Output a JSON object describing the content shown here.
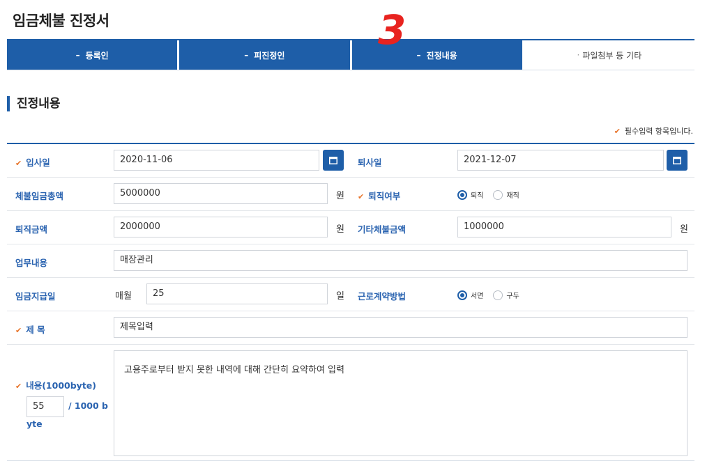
{
  "page": {
    "title": "임금체불 진정서",
    "step_mark": "3"
  },
  "tabs": [
    {
      "label": "등록인",
      "active": true
    },
    {
      "label": "피진정인",
      "active": true
    },
    {
      "label": "진정내용",
      "active": true
    },
    {
      "label": "파일첨부 등 기타",
      "active": false
    }
  ],
  "section": {
    "title": "진정내용",
    "required_note": "필수입력 항목입니다."
  },
  "form": {
    "hire_date": {
      "label": "입사일",
      "value": "2020-11-06"
    },
    "resign_date": {
      "label": "퇴사일",
      "value": "2021-12-07"
    },
    "unpaid_total": {
      "label": "체불임금총액",
      "value": "5000000",
      "unit": "원"
    },
    "resigned": {
      "label": "퇴직여부",
      "options": [
        "퇴직",
        "재직"
      ],
      "selected": "퇴직"
    },
    "severance": {
      "label": "퇴직금액",
      "value": "2000000",
      "unit": "원"
    },
    "other_unpaid": {
      "label": "기타체불금액",
      "value": "1000000",
      "unit": "원"
    },
    "job": {
      "label": "업무내용",
      "value": "매장관리"
    },
    "pay_day": {
      "label": "임금지급일",
      "prefix": "매월",
      "value": "25",
      "unit": "일"
    },
    "contract_method": {
      "label": "근로계약방법",
      "options": [
        "서면",
        "구두"
      ],
      "selected": "서면"
    },
    "subject": {
      "label": "제 목",
      "value": "제목입력"
    },
    "content": {
      "label": "내용(1000byte)",
      "value": "고용주로부터 받지 못한 내역에 대해 간단히 요약하여 입력",
      "count": "55",
      "max_label": "/ 1000 b",
      "max_label_wrap": "yte"
    }
  },
  "colors": {
    "primary": "#1e5ea8",
    "label": "#2a63b0",
    "check": "#e8742a",
    "step_mark": "#e8231f"
  }
}
